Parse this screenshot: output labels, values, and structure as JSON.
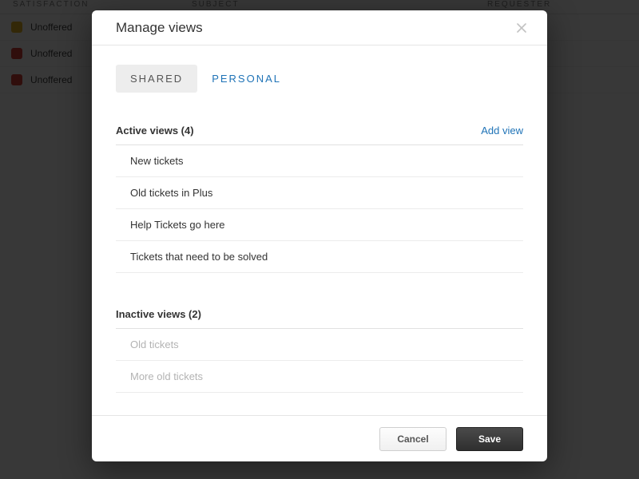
{
  "background": {
    "columns": {
      "satisfaction": "SATISFACTION",
      "subject": "SUBJECT",
      "requester": "REQUESTER"
    },
    "rows": [
      {
        "badge": "yellow",
        "status": "Unoffered"
      },
      {
        "badge": "red",
        "status": "Unoffered"
      },
      {
        "badge": "red",
        "status": "Unoffered"
      }
    ]
  },
  "modal": {
    "title": "Manage views",
    "tabs": {
      "shared": "SHARED",
      "personal": "PERSONAL"
    },
    "active_section": {
      "label": "Active views (4)",
      "add_label": "Add view",
      "items": [
        "New tickets",
        "Old tickets in Plus",
        "Help Tickets go here",
        "Tickets that need to be solved"
      ]
    },
    "inactive_section": {
      "label": "Inactive views (2)",
      "items": [
        "Old tickets",
        "More old tickets"
      ]
    },
    "footer": {
      "cancel": "Cancel",
      "save": "Save"
    }
  }
}
